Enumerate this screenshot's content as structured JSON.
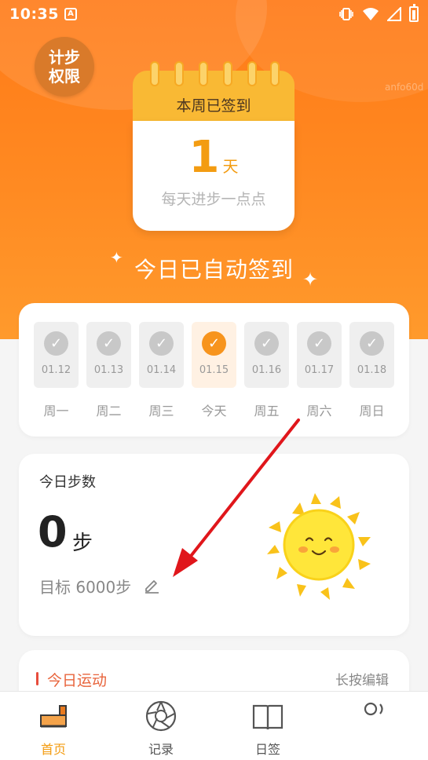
{
  "status_bar": {
    "time": "10:35",
    "app_badge": "A"
  },
  "header": {
    "permission_badge": {
      "line1": "计步",
      "line2": "权限"
    },
    "faded_text": "anfo60d"
  },
  "calendar": {
    "title": "本周已签到",
    "count": "1",
    "unit": "天",
    "motto": "每天进步一点点"
  },
  "auto_sign_text": "今日已自动签到",
  "week": [
    {
      "date": "01.12",
      "label": "周一",
      "today": false
    },
    {
      "date": "01.13",
      "label": "周二",
      "today": false
    },
    {
      "date": "01.14",
      "label": "周三",
      "today": false
    },
    {
      "date": "01.15",
      "label": "今天",
      "today": true
    },
    {
      "date": "01.16",
      "label": "周五",
      "today": false
    },
    {
      "date": "01.17",
      "label": "周六",
      "today": false
    },
    {
      "date": "01.18",
      "label": "周日",
      "today": false
    }
  ],
  "steps": {
    "title": "今日步数",
    "value": "0",
    "unit": "步",
    "goal": "目标 6000步"
  },
  "exercise": {
    "title": "今日运动",
    "edit_hint": "长按编辑"
  },
  "bottom_nav": [
    {
      "label": "首页",
      "icon": "shoe-icon",
      "active": true
    },
    {
      "label": "记录",
      "icon": "aperture-icon",
      "active": false
    },
    {
      "label": "日签",
      "icon": "book-icon",
      "active": false
    },
    {
      "label": "",
      "icon": "profile-icon",
      "active": false
    }
  ],
  "colors": {
    "accent": "#f7941d",
    "hero": "#ff7a17",
    "calendar_top": "#f9b934",
    "exercise_title": "#e8643c",
    "annotation_arrow": "#e0161b"
  }
}
